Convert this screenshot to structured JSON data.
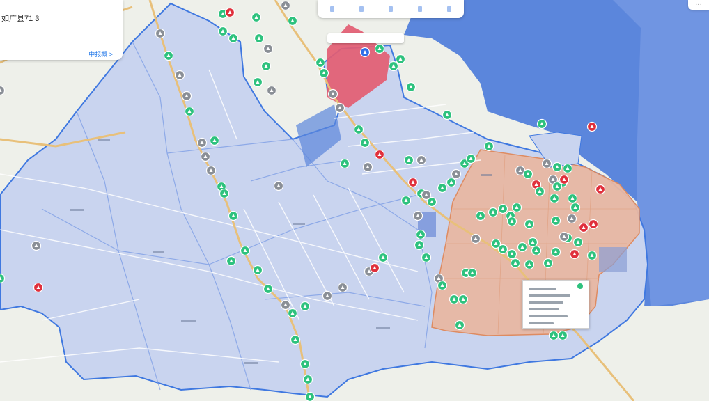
{
  "colors": {
    "land": "#eef0ea",
    "sea": "#5b86dc",
    "district": "#c9d4ef",
    "district_border": "#3f78e0",
    "zone_orange": "#e8b8a4",
    "zone_orange_border": "#e0885a",
    "zone_red": "#e35d72",
    "road_major": "#e8c07a",
    "road_minor": "#ffffff",
    "marker_green": "#2ec27e",
    "marker_grey": "#8a8f96",
    "marker_red": "#e0303c",
    "marker_blue": "#2f6ee8"
  },
  "info_card": {
    "title": "如广县71 3",
    "link": "中报概 >"
  },
  "toolbar": {
    "items": [
      "tool-1",
      "tool-2",
      "tool-3",
      "tool-4",
      "tool-5"
    ]
  },
  "close_button": {
    "label": "···"
  },
  "legend": {
    "marker_types": [
      "green-site-marker",
      "grey-site-marker",
      "red-alert-marker",
      "blue-location-marker"
    ]
  }
}
